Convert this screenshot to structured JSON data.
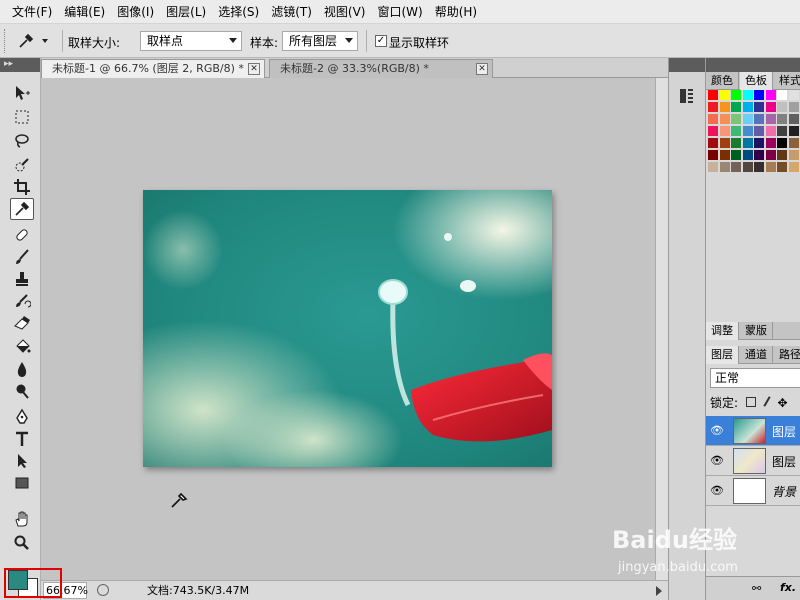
{
  "menu": [
    "文件(F)",
    "编辑(E)",
    "图像(I)",
    "图层(L)",
    "选择(S)",
    "滤镜(T)",
    "视图(V)",
    "窗口(W)",
    "帮助(H)"
  ],
  "options": {
    "sample_size_label": "取样大小:",
    "sample_size_value": "取样点",
    "sample_label": "样本:",
    "sample_value": "所有图层",
    "show_ring_label": "显示取样环",
    "show_ring_checked": "✓"
  },
  "tabs": [
    {
      "label": "未标题-1 @ 66.7% (图层 2, RGB/8) *",
      "close": "✕"
    },
    {
      "label": "未标题-2 @ 33.3%(RGB/8) *",
      "close": "✕"
    }
  ],
  "status": {
    "zoom": "66.67%",
    "doc": "文档:743.5K/3.47M"
  },
  "colors": {
    "foreground": "#2a8a82",
    "background": "#ffffff",
    "highlight": "#e00000"
  },
  "panels": {
    "color_tabs": [
      "颜色",
      "色板",
      "样式"
    ],
    "mid_tabs": [
      "调整",
      "蒙版"
    ],
    "layer_tabs": [
      "图层",
      "通道",
      "路径"
    ],
    "blend_mode": "正常",
    "lock_label": "锁定:",
    "layers": [
      {
        "name": "图层",
        "selected": true
      },
      {
        "name": "图层",
        "selected": false
      },
      {
        "name": "背景",
        "selected": false
      }
    ],
    "fx_label": "fx."
  },
  "watermark": {
    "line1": "Baidu经验",
    "line2": "jingyan.baidu.com"
  }
}
